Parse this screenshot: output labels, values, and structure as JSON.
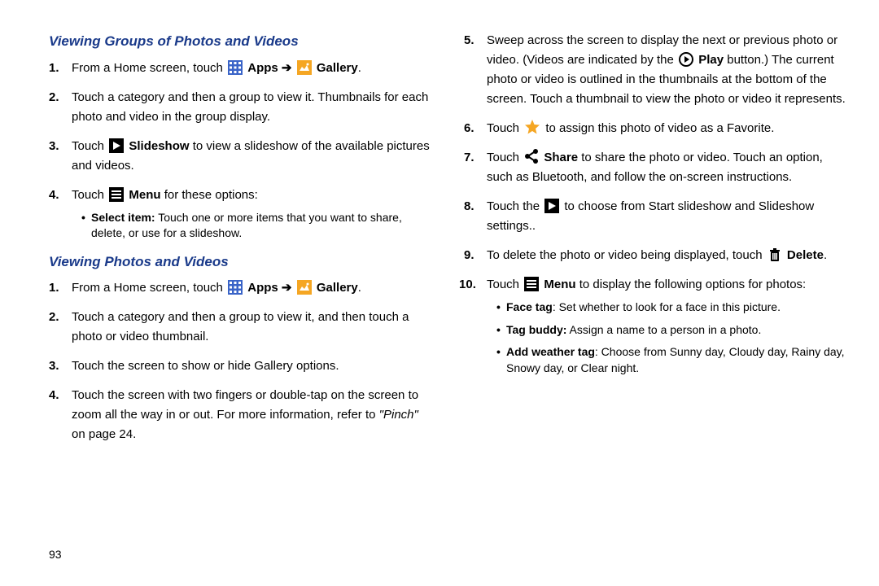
{
  "section1": {
    "heading": "Viewing Groups of Photos and Videos",
    "step1_a": "From a Home screen, touch ",
    "step1_b": " Apps ",
    "step1_c": " Gallery",
    "step2": "Touch a category and then a group to view it. Thumbnails for each photo and video in the group display.",
    "step3_a": "Touch ",
    "step3_b": " Slideshow",
    "step3_c": " to view a slideshow of the available pictures and videos.",
    "step4_a": "Touch ",
    "step4_b": " Menu",
    "step4_c": " for these options:",
    "bullet1_a": "Select item:",
    "bullet1_b": " Touch one or more items that you want to share, delete, or use for a slideshow."
  },
  "section2": {
    "heading": "Viewing Photos and Videos",
    "step1_a": "From a Home screen, touch ",
    "step1_b": " Apps ",
    "step1_c": " Gallery",
    "step2": "Touch a category and then a group to view it, and then touch a photo or video thumbnail.",
    "step3": "Touch the screen to show or hide Gallery options.",
    "step4_a": "Touch the screen with two fingers or double-tap on the screen to zoom all the way in or out. For more information, refer to ",
    "step4_b": "\"Pinch\"",
    "step4_c": " on page 24.",
    "step5_a": "Sweep across the screen to display the next or previous photo or video. (Videos are indicated by the ",
    "step5_b": " Play",
    "step5_c": " button.) The current photo or video is outlined in the thumbnails at the bottom of the screen. Touch a thumbnail to view the photo or video it represents.",
    "step6_a": "Touch ",
    "step6_b": " to assign this photo of video as a Favorite.",
    "step7_a": "Touch ",
    "step7_b": " Share",
    "step7_c": " to share the photo or video. Touch an option, such as Bluetooth, and follow the on-screen instructions.",
    "step8_a": "Touch the ",
    "step8_b": " to choose from Start slideshow and Slideshow settings..",
    "step9_a": "To delete the photo or video being displayed, touch ",
    "step9_b": " Delete",
    "step10_a": "Touch ",
    "step10_b": " Menu",
    "step10_c": " to display the following options for photos:",
    "b1a": "Face tag",
    "b1b": ": Set whether to look for a face in this picture.",
    "b2a": "Tag buddy:",
    "b2b": " Assign a name to a person in a photo.",
    "b3a": "Add weather tag",
    "b3b": ": Choose from Sunny day, Cloudy day, Rainy day, Snowy day, or Clear night."
  },
  "pageNumber": "93",
  "arrow": "➔",
  "period": "."
}
